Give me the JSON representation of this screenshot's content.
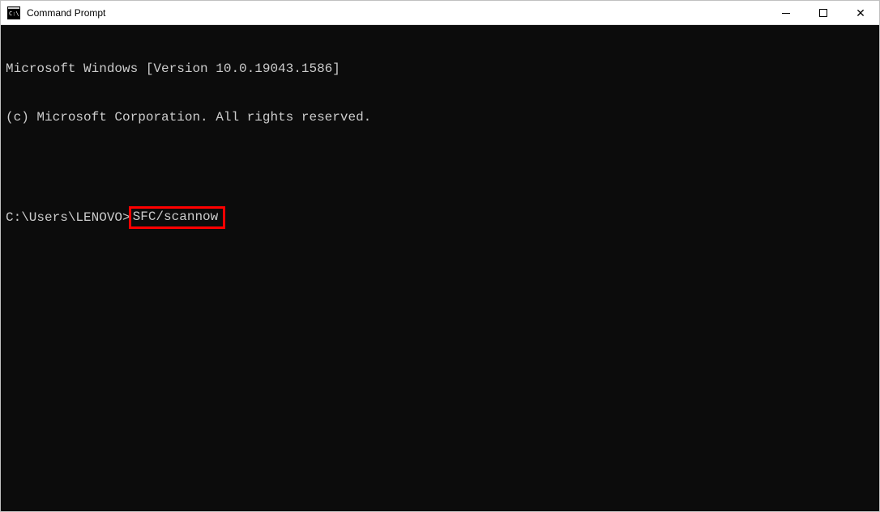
{
  "window": {
    "title": "Command Prompt"
  },
  "terminal": {
    "line1": "Microsoft Windows [Version 10.0.19043.1586]",
    "line2": "(c) Microsoft Corporation. All rights reserved.",
    "prompt": "C:\\Users\\LENOVO>",
    "command": "SFC/scannow"
  }
}
